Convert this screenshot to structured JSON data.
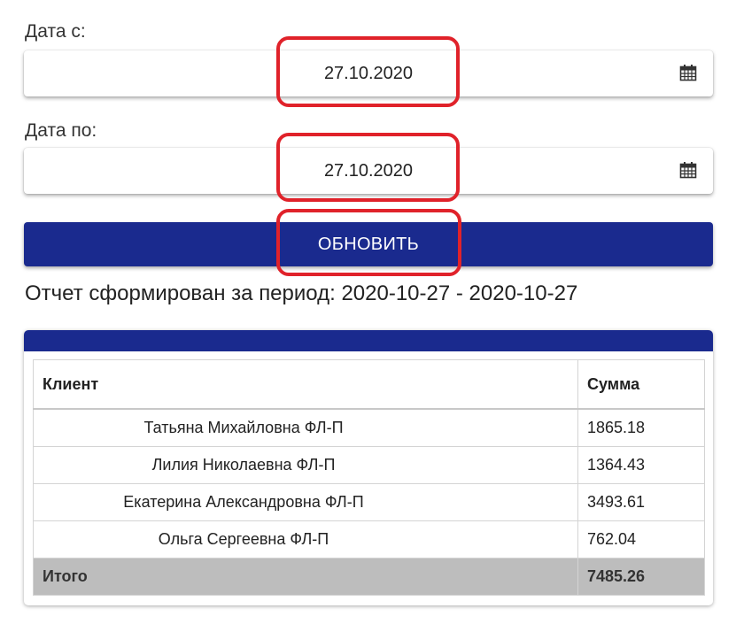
{
  "filters": {
    "date_from_label": "Дата с:",
    "date_from_value": "27.10.2020",
    "date_to_label": "Дата по:",
    "date_to_value": "27.10.2020",
    "calendar_icon": "calendar-icon"
  },
  "update_button_label": "ОБНОВИТЬ",
  "report_period_text": "Отчет сформирован за период: 2020-10-27 - 2020-10-27",
  "table": {
    "headers": [
      "Клиент",
      "Сумма"
    ],
    "rows": [
      {
        "client": "Татьяна Михайловна ФЛ-П",
        "amount": "1865.18"
      },
      {
        "client": "Лилия Николаевна ФЛ-П",
        "amount": "1364.43"
      },
      {
        "client": "Екатерина Александровна ФЛ-П",
        "amount": "3493.61"
      },
      {
        "client": "Ольга Сергеевна ФЛ-П",
        "amount": "762.04"
      }
    ],
    "total": {
      "label": "Итого",
      "amount": "7485.26"
    }
  },
  "colors": {
    "primary": "#1a2a8e",
    "highlight": "#e0222a",
    "total_row_bg": "#bdbdbd"
  }
}
